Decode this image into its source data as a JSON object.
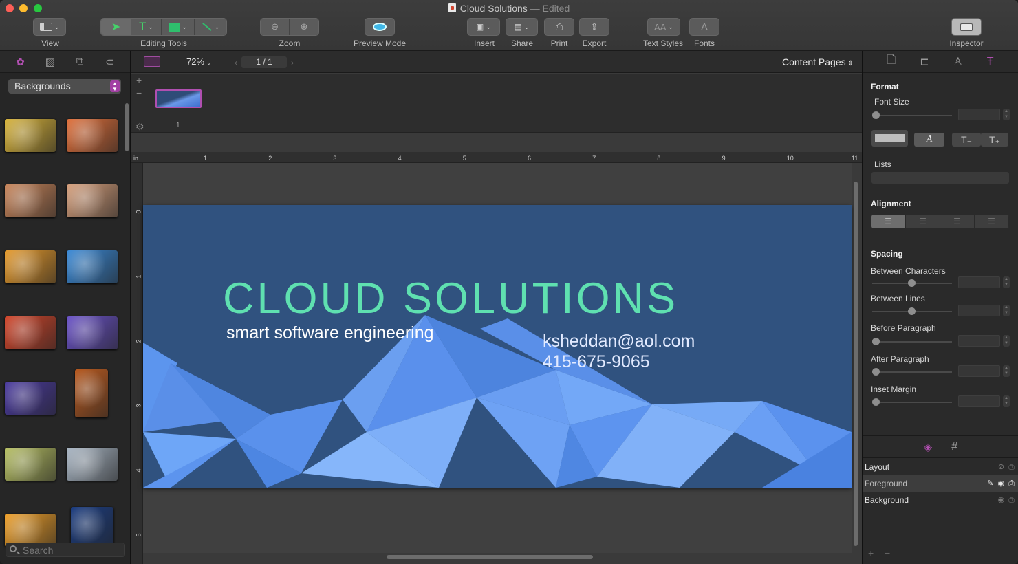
{
  "window": {
    "title": "Cloud Solutions",
    "title_suffix": "— Edited"
  },
  "toolbar": {
    "view": "View",
    "editing_tools": "Editing Tools",
    "zoom": "Zoom",
    "preview_mode": "Preview Mode",
    "insert": "Insert",
    "share": "Share",
    "print": "Print",
    "export": "Export",
    "text_styles": "Text Styles",
    "fonts": "Fonts",
    "inspector": "Inspector"
  },
  "library": {
    "category": "Backgrounds",
    "search_placeholder": "Search",
    "thumbnails": [
      "#d9b43a",
      "#e2703a",
      "#c9855a",
      "#d7a07c",
      "#e79b2c",
      "#3a8ad8",
      "#d2452a",
      "#6a52c8",
      "#4a3aa0",
      "#b85a20",
      "#b7c063",
      "#a9b6c4",
      "#f0a028",
      "#1b3c80"
    ]
  },
  "canvas_bar": {
    "zoom": "72%",
    "page": "1 / 1",
    "page_set": "Content Pages"
  },
  "page_strip": {
    "page_number": "1"
  },
  "rulers": {
    "unit": "in",
    "top": [
      "1",
      "2",
      "3",
      "4",
      "5",
      "6",
      "7",
      "8",
      "9",
      "10",
      "11"
    ],
    "left": [
      "0",
      "1",
      "2",
      "3",
      "4",
      "5"
    ]
  },
  "card": {
    "title": "CLOUD SOLUTIONS",
    "subtitle": "smart software engineering",
    "email": "ksheddan@aol.com",
    "phone": "415-675-9065",
    "colors": {
      "background": "#30527f",
      "title": "#5fe0b0",
      "mountains": "#5f94ef"
    }
  },
  "inspector": {
    "format": "Format",
    "font_size": "Font Size",
    "italic_label": "A",
    "lists": "Lists",
    "alignment": "Alignment",
    "spacing": "Spacing",
    "between_characters": "Between Characters",
    "between_lines": "Between Lines",
    "before_paragraph": "Before Paragraph",
    "after_paragraph": "After Paragraph",
    "inset_margin": "Inset Margin"
  },
  "layers": [
    {
      "name": "Layout"
    },
    {
      "name": "Foreground",
      "selected": true
    },
    {
      "name": "Background"
    }
  ],
  "accent": "#a23fa3"
}
